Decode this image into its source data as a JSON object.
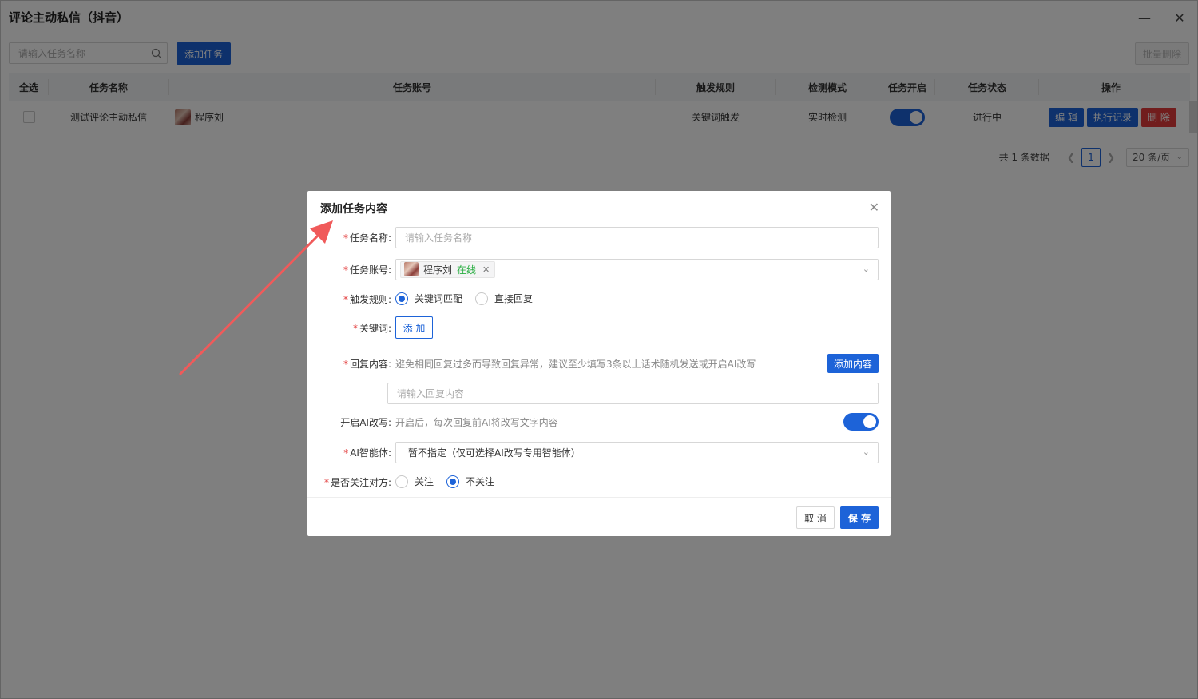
{
  "window": {
    "title": "评论主动私信（抖音）",
    "minimize": "—",
    "close": "✕"
  },
  "toolbar": {
    "search_placeholder": "请输入任务名称",
    "add_task_label": "添加任务",
    "batch_delete_label": "批量删除"
  },
  "table": {
    "headers": [
      "全选",
      "任务名称",
      "任务账号",
      "触发规则",
      "检测模式",
      "任务开启",
      "任务状态",
      "操作"
    ],
    "rows": [
      {
        "task_name": "测试评论主动私信",
        "account": "程序刘",
        "trigger_rule": "关键词触发",
        "detect_mode": "实时检测",
        "enabled": true,
        "status": "进行中",
        "actions": {
          "edit": "编 辑",
          "log": "执行记录",
          "delete": "删 除"
        }
      }
    ]
  },
  "pagination": {
    "total_text": "共 1 条数据",
    "current_page": "1",
    "page_size": "20 条/页"
  },
  "modal": {
    "title": "添加任务内容",
    "close": "✕",
    "fields": {
      "task_name": {
        "label": "任务名称:",
        "placeholder": "请输入任务名称"
      },
      "task_account": {
        "label": "任务账号:",
        "tag_name": "程序刘",
        "tag_status": "在线"
      },
      "trigger_rule": {
        "label": "触发规则:",
        "options": [
          "关键词匹配",
          "直接回复"
        ],
        "selected": "关键词匹配"
      },
      "keywords": {
        "label": "关键词:",
        "add_label": "添 加"
      },
      "reply_content": {
        "label": "回复内容:",
        "hint": "避免相同回复过多而导致回复异常，建议至少填写3条以上话术随机发送或开启AI改写",
        "add_label": "添加内容",
        "placeholder": "请输入回复内容"
      },
      "ai_rewrite": {
        "label": "开启AI改写:",
        "hint": "开启后，每次回复前AI将改写文字内容",
        "enabled": true
      },
      "ai_agent": {
        "label": "AI智能体:",
        "value": "暂不指定（仅可选择AI改写专用智能体）"
      },
      "follow": {
        "label": "是否关注对方:",
        "options": [
          "关注",
          "不关注"
        ],
        "selected": "不关注"
      }
    },
    "footer": {
      "cancel_label": "取 消",
      "save_label": "保 存"
    }
  },
  "colors": {
    "primary": "#1d63d8",
    "danger": "#e23b3b",
    "online": "#2bae43",
    "annotation_arrow": "#f05a5a"
  }
}
